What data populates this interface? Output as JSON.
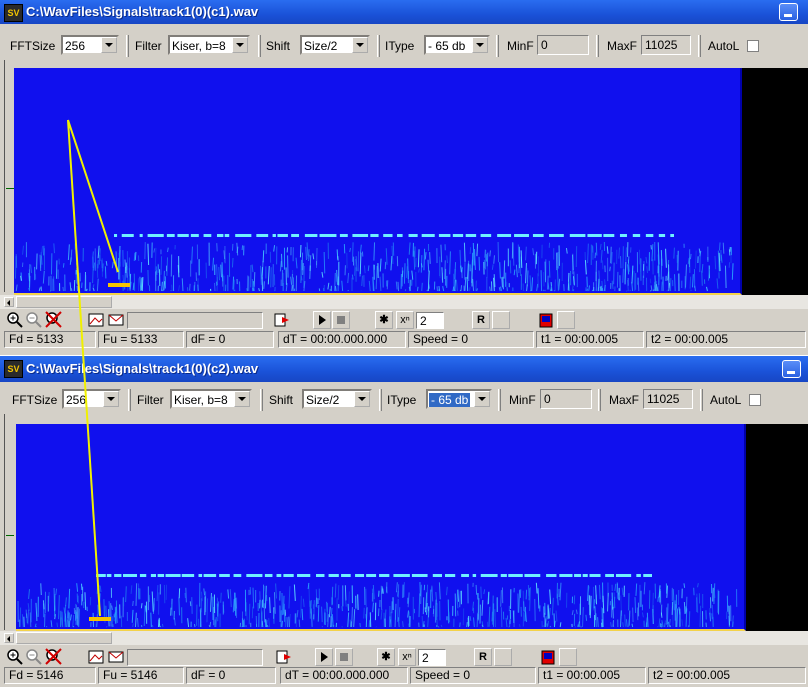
{
  "colors": {
    "titlebar": "#1a52d8",
    "spectrogram_bg": "#1010ee",
    "marker_line": "#f0f000",
    "marker_bar": "#f6c400"
  },
  "windows": [
    {
      "title": "C:\\WavFiles\\Signals\\track1(0)(c1).wav",
      "app_icon": "SV",
      "toolbar": {
        "fftsize_label": "FFTSize",
        "fftsize_value": "256",
        "filter_label": "Filter",
        "filter_value": "Kiser, b=8",
        "shift_label": "Shift",
        "shift_value": "Size/2",
        "itype_label": "IType",
        "itype_value": "- 65 db",
        "minf_label": "MinF",
        "minf_value": "0",
        "maxf_label": "MaxF",
        "maxf_value": "11025",
        "autol_label": "AutoL",
        "autol_checked": false
      },
      "tools": {
        "power_value": "2",
        "r_label": "R",
        "power_symbol": "xⁿ"
      },
      "status": {
        "fd": "Fd = 5133",
        "fu": "Fu = 5133",
        "df": "dF = 0",
        "dt": "dT = 00:00.000.000",
        "speed": "Speed = 0",
        "t1": "t1 = 00:00.005",
        "t2": "t2 = 00:00.005"
      }
    },
    {
      "title": "C:\\WavFiles\\Signals\\track1(0)(c2).wav",
      "app_icon": "SV",
      "toolbar": {
        "fftsize_label": "FFTSize",
        "fftsize_value": "256",
        "filter_label": "Filter",
        "filter_value": "Kiser, b=8",
        "shift_label": "Shift",
        "shift_value": "Size/2",
        "itype_label": "IType",
        "itype_value": "- 65 db",
        "minf_label": "MinF",
        "minf_value": "0",
        "maxf_label": "MaxF",
        "maxf_value": "11025",
        "autol_label": "AutoL",
        "autol_checked": false
      },
      "tools": {
        "power_value": "2",
        "r_label": "R",
        "power_symbol": "xⁿ"
      },
      "status": {
        "fd": "Fd = 5146",
        "fu": "Fu = 5146",
        "df": "dF = 0",
        "dt": "dT = 00:00.000.000",
        "speed": "Speed = 0",
        "t1": "t1 = 00:00.005",
        "t2": "t2 = 00:00.005"
      }
    }
  ]
}
